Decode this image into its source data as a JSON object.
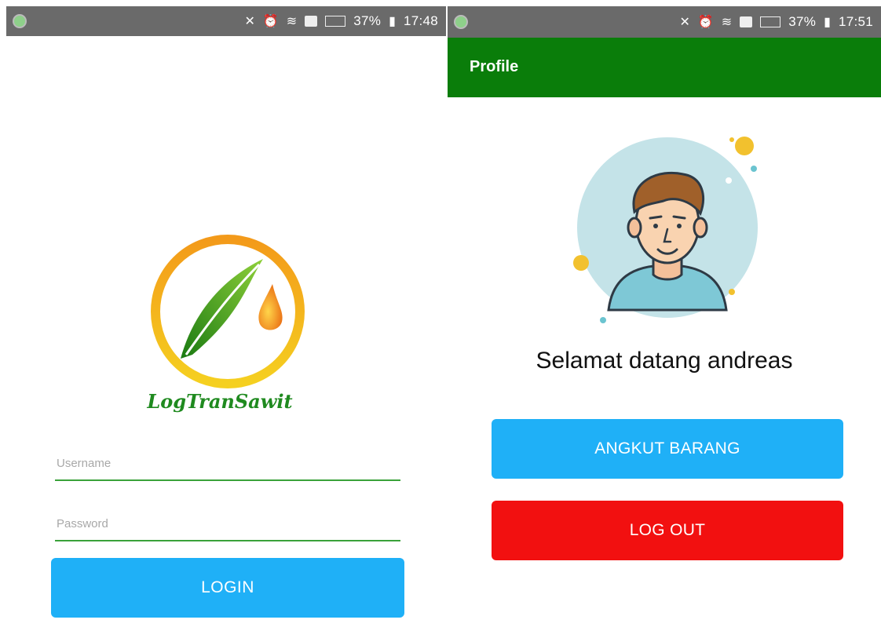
{
  "status_bar_left": {
    "battery": "37%",
    "time": "17:48"
  },
  "status_bar_right": {
    "battery": "37%",
    "time": "17:51"
  },
  "login": {
    "logo_text": "LogTranSawit",
    "username_placeholder": "Username",
    "password_placeholder": "Password",
    "login_label": "LOGIN"
  },
  "profile": {
    "title": "Profile",
    "welcome": "Selamat datang andreas",
    "angkut_label": "ANGKUT BARANG",
    "logout_label": "LOG OUT"
  },
  "colors": {
    "appbar": "#0a7d0a",
    "primary_button": "#1fb0f7",
    "logout_button": "#f21010",
    "field_underline": "#3aa23a"
  }
}
